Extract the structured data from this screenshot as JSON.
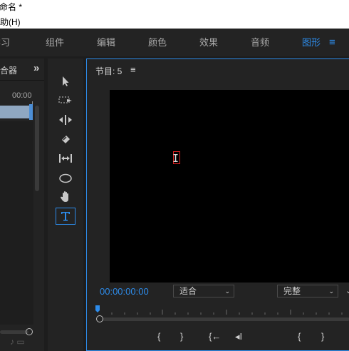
{
  "window": {
    "title": "未命名 *",
    "help_menu": "帮助(H)"
  },
  "workspaces": {
    "items": [
      "学习",
      "组件",
      "编辑",
      "颜色",
      "效果",
      "音频",
      "图形"
    ],
    "active": "图形"
  },
  "left_panel": {
    "tab_label": "混合器",
    "timecode": "00:00"
  },
  "program_monitor": {
    "title": "节目: 5",
    "timecode": "00:00:00:00",
    "zoom_value": "适合",
    "quality_value": "完整"
  },
  "tools": [
    "selection-tool",
    "track-select-tool",
    "ripple-edit-tool",
    "razor-tool",
    "slip-tool",
    "ellipse-tool",
    "hand-tool",
    "type-tool"
  ],
  "colors": {
    "accent": "#2d8ceb",
    "panel": "#232323",
    "background": "#1d1d1d"
  }
}
